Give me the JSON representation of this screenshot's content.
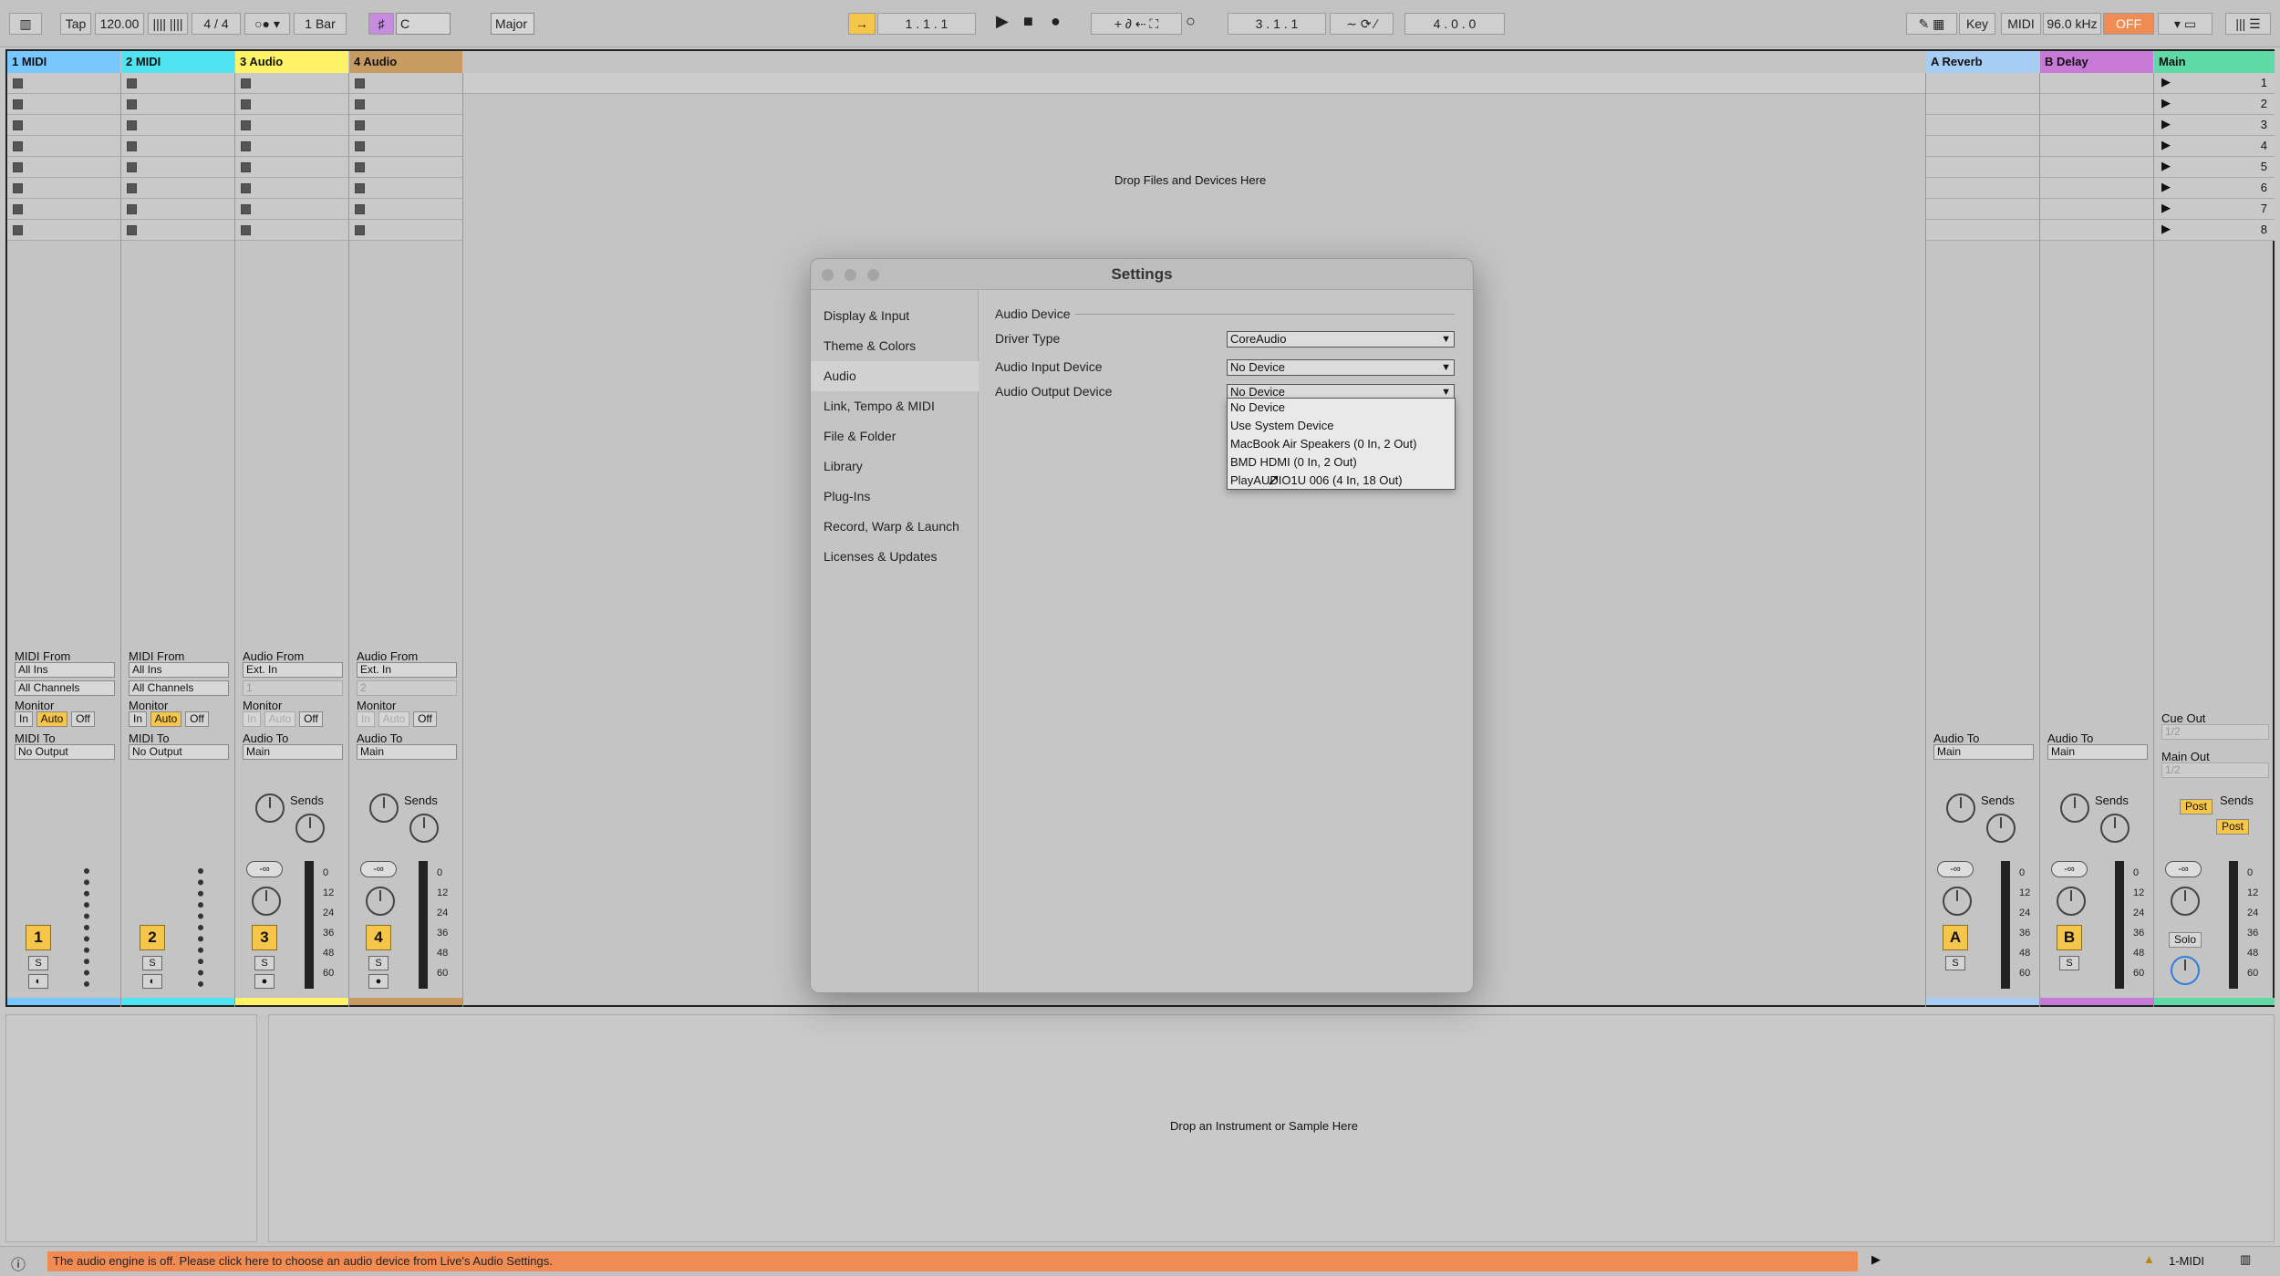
{
  "toolbar": {
    "tap": "Tap",
    "tempo": "120.00",
    "signature": "4 / 4",
    "quantize": "1 Bar",
    "key": "C",
    "scale": "Major",
    "arrangement_position": "1 .   1 .   1",
    "loop_start": "3 .   1 .   1",
    "loop_length": "4 .   0 .   0",
    "key_map": "Key",
    "midi_map": "MIDI",
    "sample_rate": "96.0 kHz",
    "engine_state": "OFF"
  },
  "tracks": [
    {
      "name": "1 MIDI",
      "color": "#79c7ff",
      "number": "1"
    },
    {
      "name": "2 MIDI",
      "color": "#4ee4f2",
      "number": "2"
    },
    {
      "name": "3 Audio",
      "color": "#fff266",
      "number": "3"
    },
    {
      "name": "4 Audio",
      "color": "#c79b62",
      "number": "4"
    }
  ],
  "returns": [
    {
      "name": "A Reverb",
      "color": "#a8cdf5",
      "letter": "A"
    },
    {
      "name": "B Delay",
      "color": "#c779d8",
      "letter": "B"
    }
  ],
  "main_track": {
    "name": "Main",
    "color": "#5fd9a5",
    "scenes": [
      "1",
      "2",
      "3",
      "4",
      "5",
      "6",
      "7",
      "8"
    ]
  },
  "session": {
    "drop_hint": "Drop Files and Devices Here"
  },
  "io": {
    "midi_from": "MIDI From",
    "all_ins": "All Ins",
    "all_channels": "All Channels",
    "monitor": "Monitor",
    "in": "In",
    "auto": "Auto",
    "off": "Off",
    "midi_to": "MIDI To",
    "no_output": "No Output",
    "audio_from": "Audio From",
    "ext_in": "Ext. In",
    "ch1": "1",
    "ch2": "2",
    "audio_to": "Audio To",
    "main": "Main",
    "cue_out": "Cue Out",
    "main_out": "Main Out",
    "cue_val": "1/2",
    "main_out_val": "1/2",
    "sends": "Sends",
    "post": "Post",
    "solo": "Solo",
    "s": "S",
    "volume": "-∞",
    "knob_a": "A",
    "knob_b": "B",
    "scale_labels": [
      "0",
      "12",
      "24",
      "36",
      "48",
      "60"
    ]
  },
  "settings": {
    "title": "Settings",
    "nav": [
      "Display & Input",
      "Theme & Colors",
      "Audio",
      "Link, Tempo & MIDI",
      "File & Folder",
      "Library",
      "Plug-Ins",
      "Record, Warp & Launch",
      "Licenses & Updates"
    ],
    "active_nav": "Audio",
    "section": "Audio Device",
    "driver_type_label": "Driver Type",
    "driver_type_value": "CoreAudio",
    "input_label": "Audio Input Device",
    "input_value": "No Device",
    "output_label": "Audio Output Device",
    "output_value": "No Device",
    "output_options": [
      "No Device",
      "Use System Device",
      "MacBook Air Speakers (0 In, 2 Out)",
      "BMD HDMI (0 In, 2 Out)",
      "PlayAUDIO1U 006 (4 In, 18 Out)"
    ]
  },
  "detail": {
    "drop_hint": "Drop an Instrument or Sample Here"
  },
  "status": {
    "message": "The audio engine is off. Please click here to choose an audio device from Live's Audio Settings.",
    "track": "1-MIDI"
  }
}
